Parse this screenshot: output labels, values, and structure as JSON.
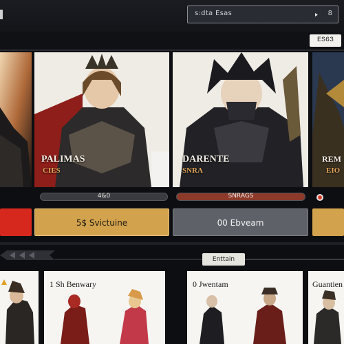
{
  "search": {
    "text": "s:dta Esas",
    "count": "8"
  },
  "top_badge": "ES63",
  "heroes": [
    {
      "name": "",
      "class": ""
    },
    {
      "name": "PALIMAS",
      "class": "CIES"
    },
    {
      "name": "DARENTE",
      "class": "SNRA"
    },
    {
      "name": "REM",
      "class": "EIO"
    }
  ],
  "stat_pills": [
    "4&0",
    "SNRAGS"
  ],
  "actions": {
    "gold_label": "5$ Svictuine",
    "gray_label": "00 Ebveam"
  },
  "section_label": "Enttain",
  "lower_cards": [
    {
      "title": ""
    },
    {
      "title": "1 Sh Benwary"
    },
    {
      "title": "0 Jwentam"
    },
    {
      "title": "Guantien"
    }
  ],
  "colors": {
    "gold": "#d2a24d",
    "gray_button": "#5f6169",
    "red": "#d7281e",
    "background": "#0d0e11"
  }
}
